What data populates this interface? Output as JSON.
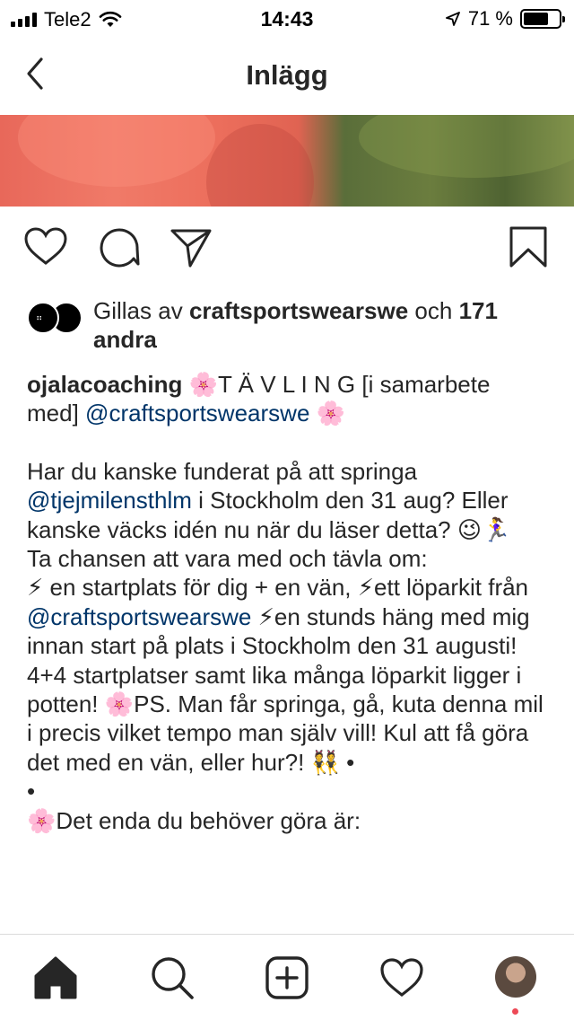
{
  "status_bar": {
    "carrier": "Tele2",
    "time": "14:43",
    "battery_text": "71 %",
    "battery_level": 0.71
  },
  "nav": {
    "title": "Inlägg"
  },
  "likes": {
    "prefix": "Gillas av",
    "user": "craftsportswearswe",
    "conjunction": "och",
    "count": "171",
    "suffix": "andra"
  },
  "caption": {
    "username": "ojalacoaching",
    "line1_rest": "T Ä V L I N G [i samarbete med]",
    "mention_craft": "@craftsportswearswe",
    "p1_a": "Har du kanske funderat på att springa",
    "mention_tjej": "@tjejmilensthlm",
    "p1_b": "i Stockholm den 31 aug? Eller kanske väcks idén nu när du läser detta?",
    "p2": "Ta chansen att vara med och tävla om:",
    "p3_a": "en startplats för dig + en vän,",
    "p3_b": "ett löparkit från",
    "p3_c": "en stunds häng med mig innan start på plats i Stockholm den 31 augusti!",
    "p4_a": "4+4 startplatser samt lika många löparkit ligger i potten!",
    "p4_b": "PS. Man får springa, gå, kuta denna mil i precis vilket tempo man själv vill! Kul att få göra det med en vän, eller hur?!",
    "bullet": "•",
    "p5": "Det enda du behöver göra är:"
  },
  "icons": {
    "heart": "heart-icon",
    "comment": "comment-icon",
    "share": "share-icon",
    "bookmark": "bookmark-icon",
    "home": "home-icon",
    "search": "search-icon",
    "add": "add-post-icon",
    "activity": "activity-heart-icon"
  },
  "colors": {
    "mention": "#003569",
    "text": "#262626",
    "notification": "#ed4956"
  }
}
